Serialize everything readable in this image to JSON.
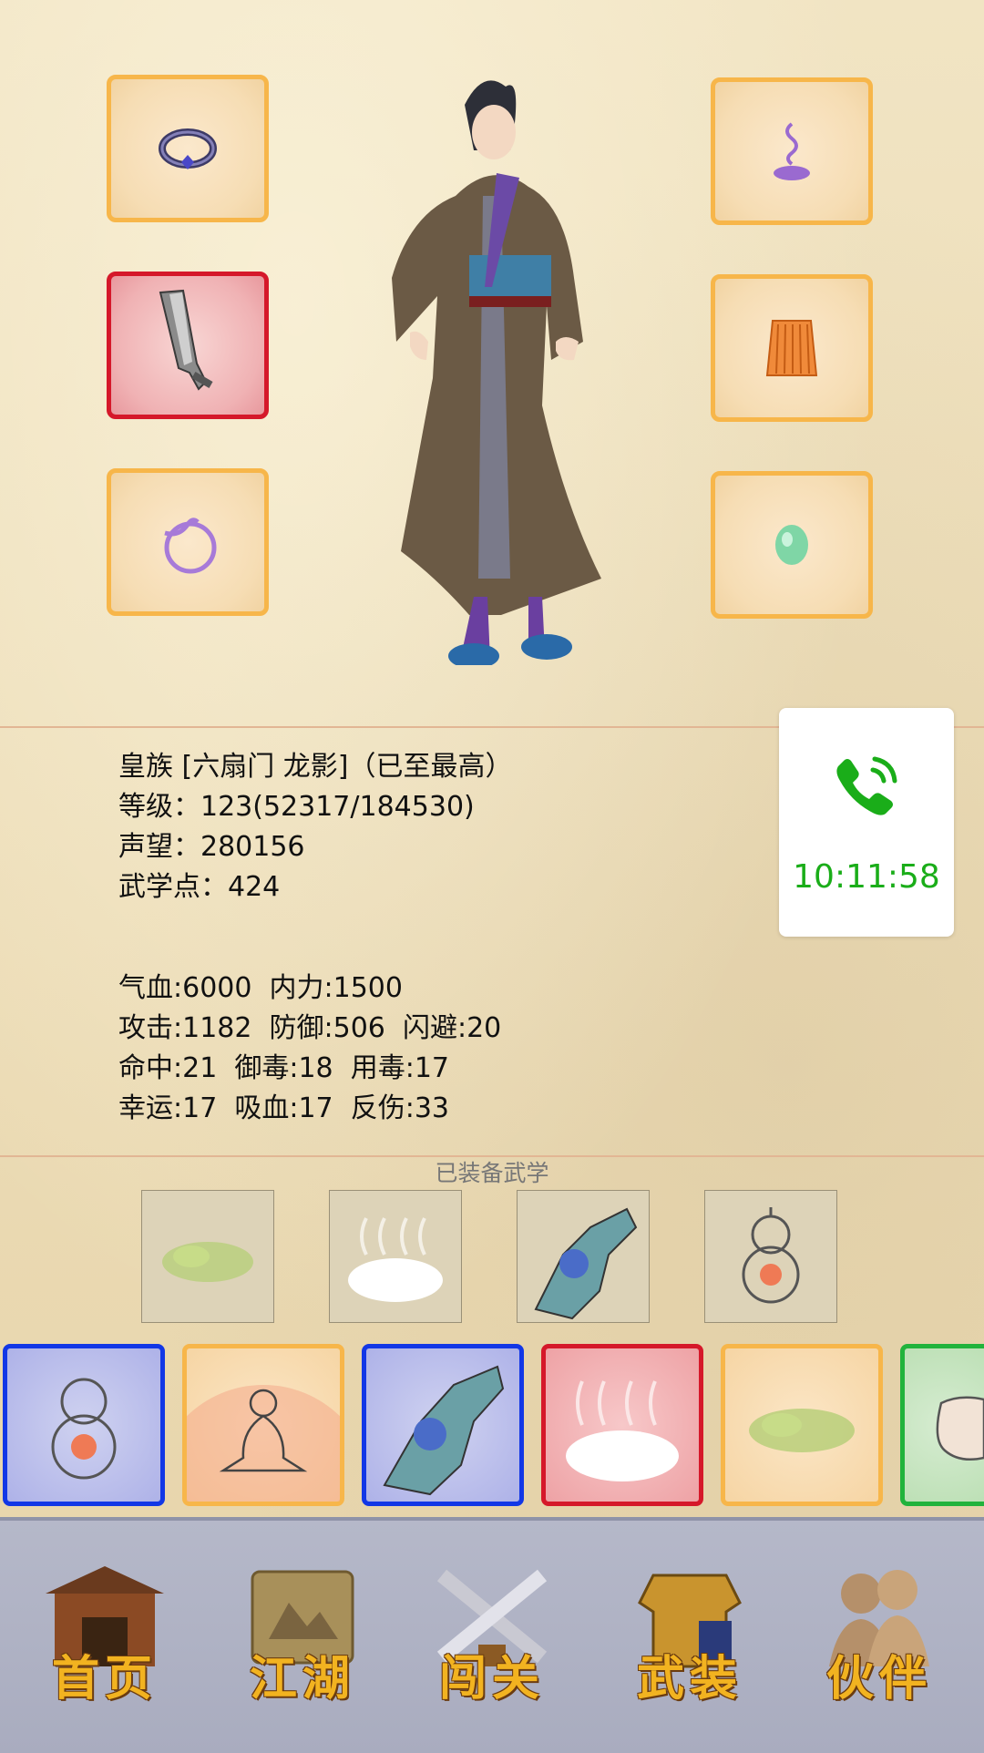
{
  "character": {
    "title_line": "皇族 [六扇门 龙影]（已至最高）",
    "level_line": "等级：123(52317/184530)",
    "prestige_line": "声望：280156",
    "martial_points_line": "武学点：424"
  },
  "stats": {
    "row1": "气血:6000  内力:1500",
    "row2": "攻击:1182  防御:506  闪避:20",
    "row3": "命中:21  御毒:18  用毒:17",
    "row4": "幸运:17  吸血:17  反伤:33"
  },
  "call_overlay": {
    "icon": "phone-icon",
    "time": "10:11:58",
    "color": "#1aad19"
  },
  "equipment_slots": [
    {
      "icon": "ring-icon",
      "rarity_color": "#f7b64a"
    },
    {
      "icon": "sword-icon",
      "rarity_color": "#d5182a"
    },
    {
      "icon": "bracelet-icon",
      "rarity_color": "#f7b64a"
    },
    {
      "icon": "incense-icon",
      "rarity_color": "#f7b64a"
    },
    {
      "icon": "robe-skirt-icon",
      "rarity_color": "#f7b64a"
    },
    {
      "icon": "jade-icon",
      "rarity_color": "#f7b64a"
    }
  ],
  "equipped_skills": {
    "label": "已装备武学",
    "items": [
      "poison-mist-icon",
      "steam-cloud-icon",
      "palm-strike-icon",
      "gourd-icon"
    ]
  },
  "skill_bar": [
    {
      "icon": "gourd-icon",
      "rarity": "blue"
    },
    {
      "icon": "meditation-icon",
      "rarity": "orange"
    },
    {
      "icon": "palm-strike-icon",
      "rarity": "blue"
    },
    {
      "icon": "steam-cloud-icon",
      "rarity": "red"
    },
    {
      "icon": "poison-mist-icon",
      "rarity": "orange"
    },
    {
      "icon": "fist-icon",
      "rarity": "green"
    }
  ],
  "bottom_nav": [
    {
      "label": "首页",
      "icon": "house-icon"
    },
    {
      "label": "江湖",
      "icon": "scroll-icon"
    },
    {
      "label": "闯关",
      "icon": "crossed-swords-icon"
    },
    {
      "label": "武装",
      "icon": "armor-icon"
    },
    {
      "label": "伙伴",
      "icon": "companions-icon"
    }
  ]
}
